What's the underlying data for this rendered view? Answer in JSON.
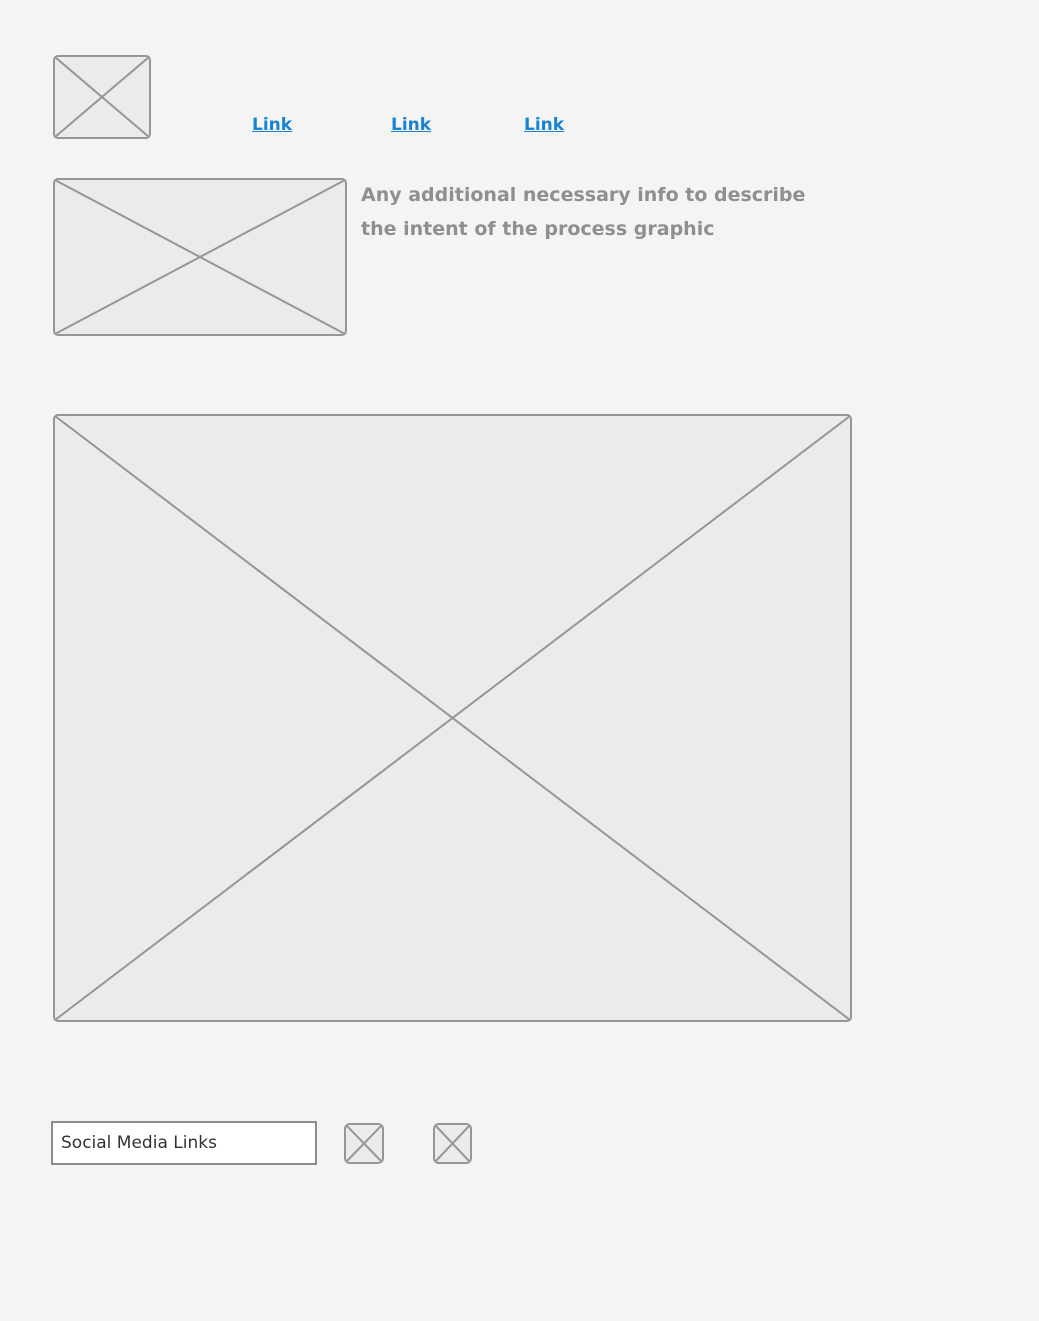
{
  "nav": {
    "links": [
      "Link",
      "Link",
      "Link"
    ]
  },
  "process": {
    "description": "Any additional necessary info to describe the intent of the process graphic"
  },
  "footer": {
    "social_label": "Social Media Links"
  },
  "colors": {
    "background": "#f4f4f4",
    "placeholder_fill": "#ebebeb",
    "placeholder_stroke": "#969696",
    "link": "#1a82cf",
    "muted_text": "#8f8f8f"
  },
  "icons": {
    "logo": "image-placeholder-icon",
    "process_thumbnail": "image-placeholder-icon",
    "process_graphic": "image-placeholder-icon",
    "social_icons": [
      "image-placeholder-icon",
      "image-placeholder-icon"
    ]
  }
}
